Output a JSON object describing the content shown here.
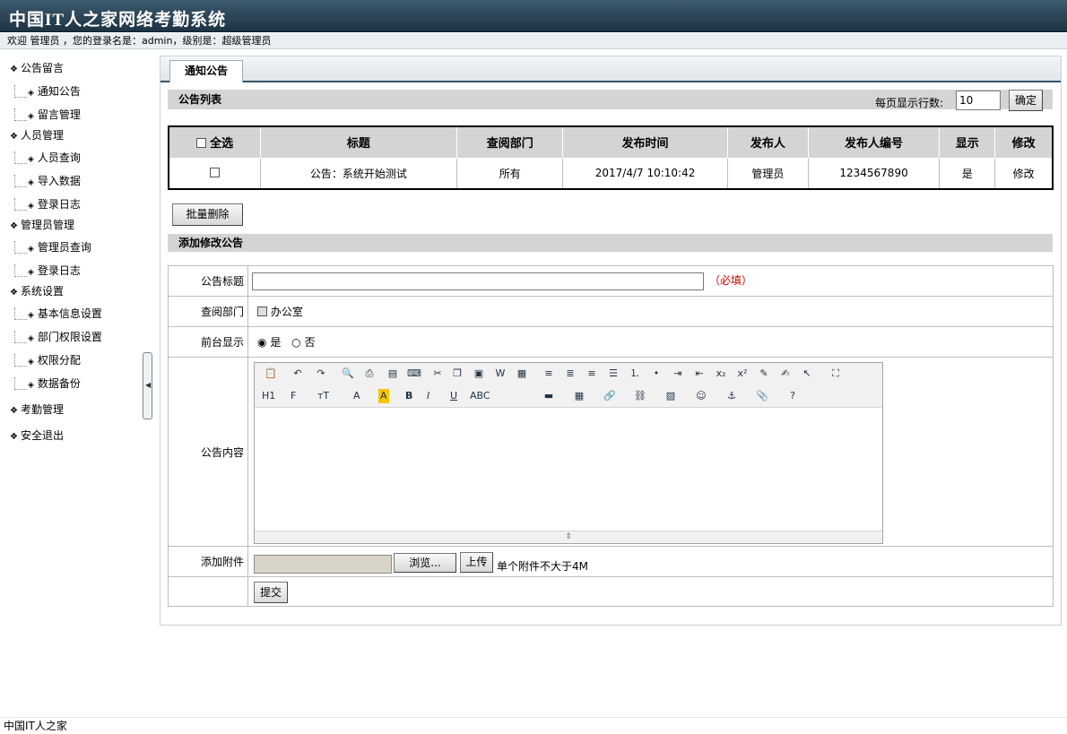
{
  "header": {
    "title": "中国IT人之家网络考勤系统"
  },
  "welcome": {
    "text": "欢迎 管理员 ，您的登录名是：admin，级别是：超级管理员"
  },
  "sidebar": {
    "groups": [
      {
        "label": "公告留言",
        "items": [
          "通知公告",
          "留言管理"
        ]
      },
      {
        "label": "人员管理",
        "items": [
          "人员查询",
          "导入数据",
          "登录日志"
        ]
      },
      {
        "label": "管理员管理",
        "items": [
          "管理员查询",
          "登录日志"
        ]
      },
      {
        "label": "系统设置",
        "items": [
          "基本信息设置",
          "部门权限设置",
          "权限分配",
          "数据备份"
        ]
      },
      {
        "label": "考勤管理",
        "items": []
      },
      {
        "label": "安全退出",
        "items": []
      }
    ]
  },
  "tab": {
    "label": "通知公告"
  },
  "list": {
    "section_title": "公告列表",
    "perpage_label": "每页显示行数:",
    "perpage_value": "10",
    "confirm_label": "确定",
    "select_all": "全选",
    "columns": [
      "标题",
      "查阅部门",
      "发布时间",
      "发布人",
      "发布人编号",
      "显示",
      "修改"
    ],
    "rows": [
      {
        "title": "公告：系统开始测试",
        "dept": "所有",
        "time": "2017/4/7 10:10:42",
        "publisher": "管理员",
        "publisher_id": "1234567890",
        "show": "是",
        "edit": "修改"
      }
    ],
    "batch_delete": "批量删除"
  },
  "form": {
    "section_title": "添加修改公告",
    "title_label": "公告标题",
    "title_value": "",
    "required": "（必填）",
    "dept_label": "查阅部门",
    "dept_option": "办公室",
    "display_label": "前台显示",
    "display_yes": "是",
    "display_no": "否",
    "content_label": "公告内容",
    "attach_label": "添加附件",
    "browse": "浏览...",
    "upload": "上传",
    "attach_note": "单个附件不大于4M",
    "submit": "提交"
  },
  "editor_toolbar": {
    "row1": [
      "paste-icon",
      "undo-icon",
      "redo-icon",
      "preview-icon",
      "print-icon",
      "template-icon",
      "code-icon",
      "cut-icon",
      "copy-icon",
      "paste-text-icon",
      "paste-word-icon",
      "select-all-icon",
      "align-left-icon",
      "align-center-icon",
      "align-right-icon",
      "justify-icon",
      "ordered-list-icon",
      "unordered-list-icon",
      "indent-icon",
      "outdent-icon",
      "subscript-icon",
      "superscript-icon",
      "clear-format-icon",
      "quick-format-icon",
      "select-icon",
      "fullscreen-icon"
    ],
    "row2_text": [
      "H1",
      "F",
      "тT",
      "A",
      "A",
      "B",
      "I",
      "U",
      "ABC"
    ]
  },
  "footer": {
    "text": "中国IT人之家"
  }
}
